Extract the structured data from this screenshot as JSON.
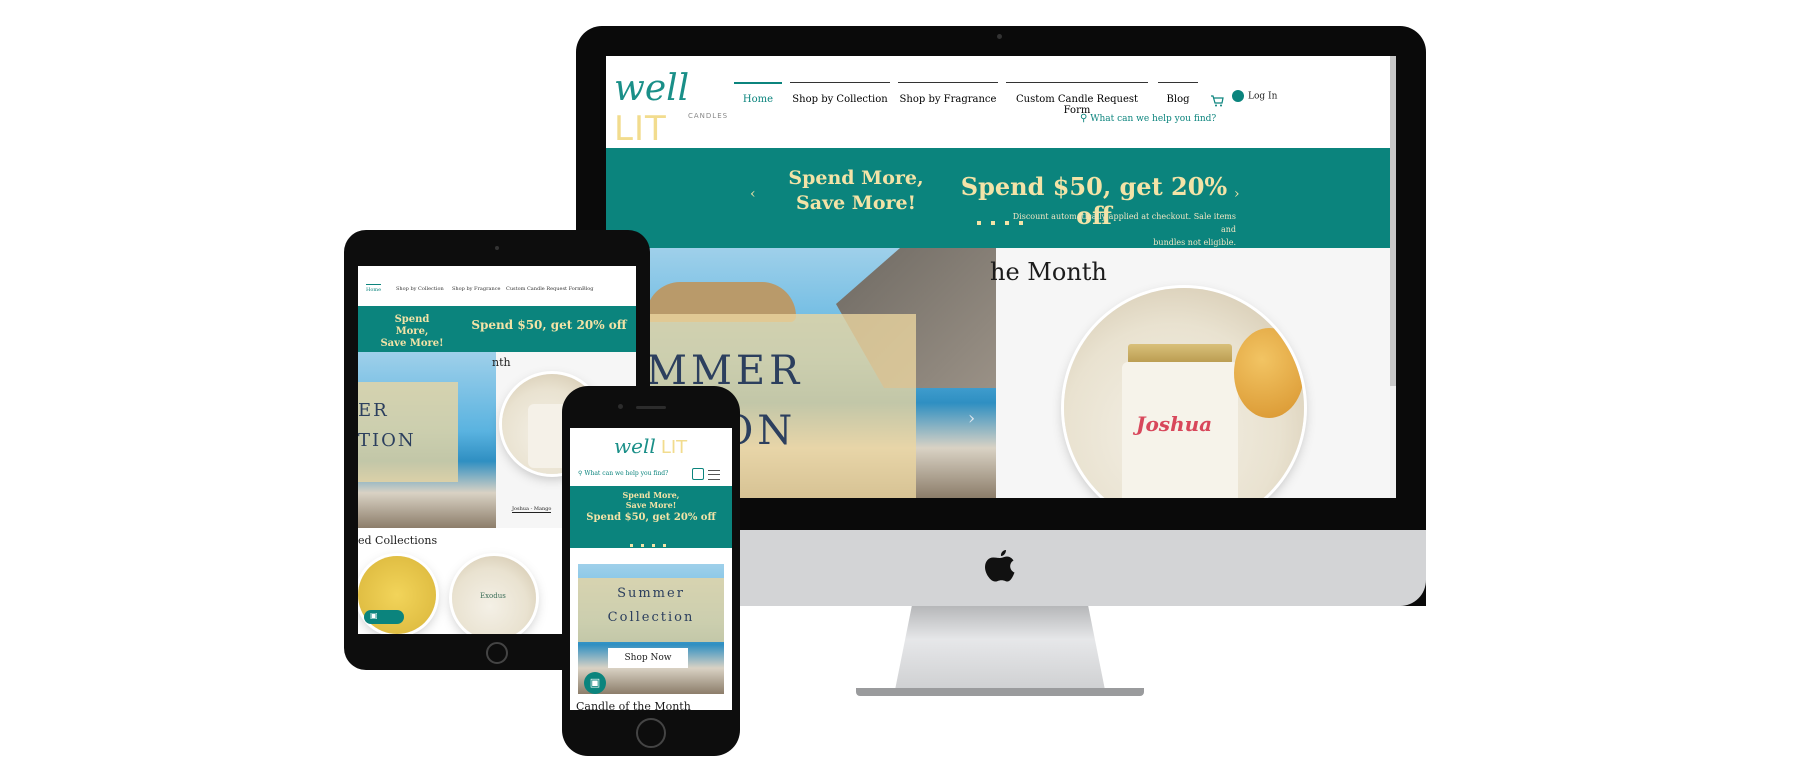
{
  "brand": {
    "name_primary": "well",
    "name_secondary": "LIT",
    "tagline": "CANDLES"
  },
  "nav": {
    "items": [
      "Home",
      "Shop by Collection",
      "Shop by Fragrance",
      "Custom Candle Request Form",
      "Blog"
    ],
    "login": "Log In",
    "cart_count": "0",
    "search_placeholder": "What can we help you find?"
  },
  "promo": {
    "left_line1": "Spend More,",
    "left_line2": "Save More!",
    "headline": "Spend $50, get 20% off",
    "subtext_line1": "Discount automatically applied at checkout. Sale items and",
    "subtext_line2": "bundles not eligible."
  },
  "hero": {
    "desktop_line1": "MMER",
    "desktop_line2": "TION",
    "tablet_line1": "ER",
    "tablet_line2": "TION",
    "mobile_line1": "Summer",
    "mobile_line2": "Collection",
    "shop_now": "Shop Now"
  },
  "candle_of_month": {
    "heading_fragment": "he Month",
    "tablet_fragment": "nth",
    "mobile_heading": "Candle of the Month",
    "candle_name": "Joshua",
    "tablet_caption": "Joshua - Mango"
  },
  "featured": {
    "tablet_heading": "ed Collections",
    "label_exodus": "Exodus"
  },
  "icons": {
    "search": "search-icon",
    "cart": "cart-icon",
    "user": "user-icon",
    "gift": "gift-icon",
    "apple": "apple-logo-icon",
    "menu": "hamburger-menu-icon"
  },
  "colors": {
    "teal": "#0b847d",
    "gold": "#f3e3a7",
    "sand": "#ecd6a0"
  }
}
